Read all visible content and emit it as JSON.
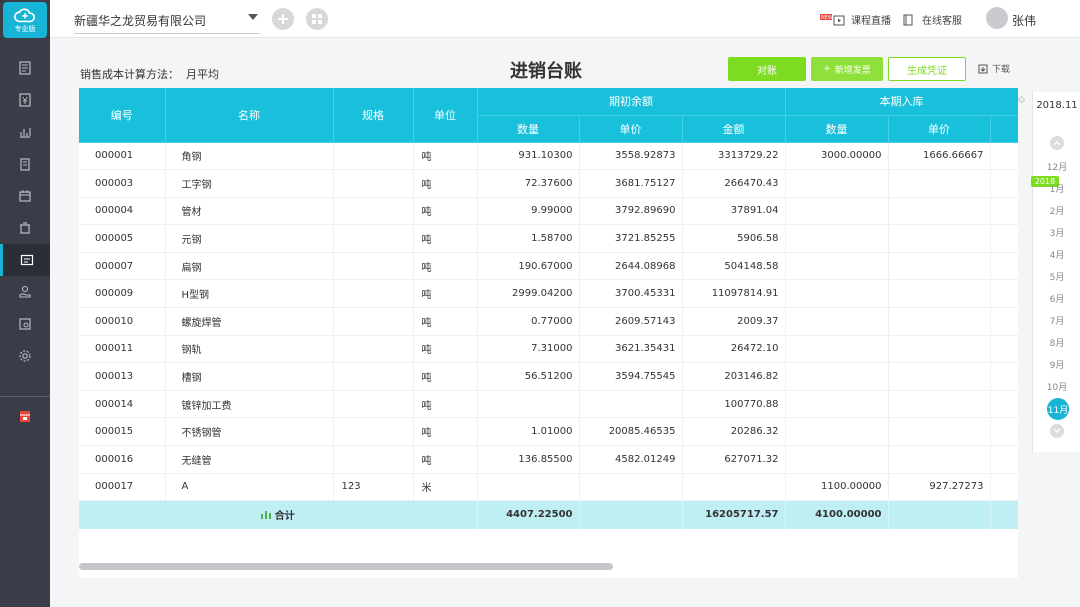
{
  "app": {
    "logo_label": "专业版"
  },
  "topbar": {
    "company": "新疆华之龙贸易有限公司",
    "live_label": "课程直播",
    "service_label": "在线客服",
    "user_name": "张伟"
  },
  "header": {
    "method_label": "销售成本计算方法：",
    "method_value": "月平均",
    "title": "进销台账",
    "recon_button": "对账",
    "add_invoice_button": "新增发票",
    "generate_voucher_button": "生成凭证",
    "download_button": "下载"
  },
  "table": {
    "col_code": "编号",
    "col_name": "名称",
    "col_spec": "规格",
    "col_unit": "单位",
    "group_opening": "期初余额",
    "group_in": "本期入库",
    "sub_qty": "数量",
    "sub_price": "单价",
    "sub_amount": "金额",
    "rows": [
      {
        "code": "000001",
        "name": "角钢",
        "spec": "",
        "unit": "吨",
        "o_qty": "931.10300",
        "o_price": "3558.92873",
        "o_amt": "3313729.22",
        "i_qty": "3000.00000",
        "i_price": "1666.66667"
      },
      {
        "code": "000003",
        "name": "工字钢",
        "spec": "",
        "unit": "吨",
        "o_qty": "72.37600",
        "o_price": "3681.75127",
        "o_amt": "266470.43",
        "i_qty": "",
        "i_price": ""
      },
      {
        "code": "000004",
        "name": "管材",
        "spec": "",
        "unit": "吨",
        "o_qty": "9.99000",
        "o_price": "3792.89690",
        "o_amt": "37891.04",
        "i_qty": "",
        "i_price": ""
      },
      {
        "code": "000005",
        "name": "元钢",
        "spec": "",
        "unit": "吨",
        "o_qty": "1.58700",
        "o_price": "3721.85255",
        "o_amt": "5906.58",
        "i_qty": "",
        "i_price": ""
      },
      {
        "code": "000007",
        "name": "扁钢",
        "spec": "",
        "unit": "吨",
        "o_qty": "190.67000",
        "o_price": "2644.08968",
        "o_amt": "504148.58",
        "i_qty": "",
        "i_price": ""
      },
      {
        "code": "000009",
        "name": "H型钢",
        "spec": "",
        "unit": "吨",
        "o_qty": "2999.04200",
        "o_price": "3700.45331",
        "o_amt": "11097814.91",
        "i_qty": "",
        "i_price": ""
      },
      {
        "code": "000010",
        "name": "螺旋焊管",
        "spec": "",
        "unit": "吨",
        "o_qty": "0.77000",
        "o_price": "2609.57143",
        "o_amt": "2009.37",
        "i_qty": "",
        "i_price": ""
      },
      {
        "code": "000011",
        "name": "钢轨",
        "spec": "",
        "unit": "吨",
        "o_qty": "7.31000",
        "o_price": "3621.35431",
        "o_amt": "26472.10",
        "i_qty": "",
        "i_price": ""
      },
      {
        "code": "000013",
        "name": "槽钢",
        "spec": "",
        "unit": "吨",
        "o_qty": "56.51200",
        "o_price": "3594.75545",
        "o_amt": "203146.82",
        "i_qty": "",
        "i_price": ""
      },
      {
        "code": "000014",
        "name": "镀锌加工费",
        "spec": "",
        "unit": "吨",
        "o_qty": "",
        "o_price": "",
        "o_amt": "100770.88",
        "i_qty": "",
        "i_price": ""
      },
      {
        "code": "000015",
        "name": "不锈钢管",
        "spec": "",
        "unit": "吨",
        "o_qty": "1.01000",
        "o_price": "20085.46535",
        "o_amt": "20286.32",
        "i_qty": "",
        "i_price": ""
      },
      {
        "code": "000016",
        "name": "无缝管",
        "spec": "",
        "unit": "吨",
        "o_qty": "136.85500",
        "o_price": "4582.01249",
        "o_amt": "627071.32",
        "i_qty": "",
        "i_price": ""
      },
      {
        "code": "000017",
        "name": "A",
        "spec": "123",
        "unit": "米",
        "o_qty": "",
        "o_price": "",
        "o_amt": "",
        "i_qty": "1100.00000",
        "i_price": "927.27273"
      }
    ],
    "total": {
      "label": "合计",
      "o_qty": "4407.22500",
      "o_amt": "16205717.57",
      "i_qty": "4100.00000"
    }
  },
  "months": {
    "current": "2018.11",
    "prev_year_month": "12月",
    "year_tag": "2018",
    "items": [
      "1月",
      "2月",
      "3月",
      "4月",
      "5月",
      "6月",
      "7月",
      "8月",
      "9月",
      "10月"
    ],
    "active": "11月"
  },
  "colors": {
    "accent": "#18c0dc",
    "green": "#7ddc1f",
    "sidebar": "#3a3d48"
  }
}
